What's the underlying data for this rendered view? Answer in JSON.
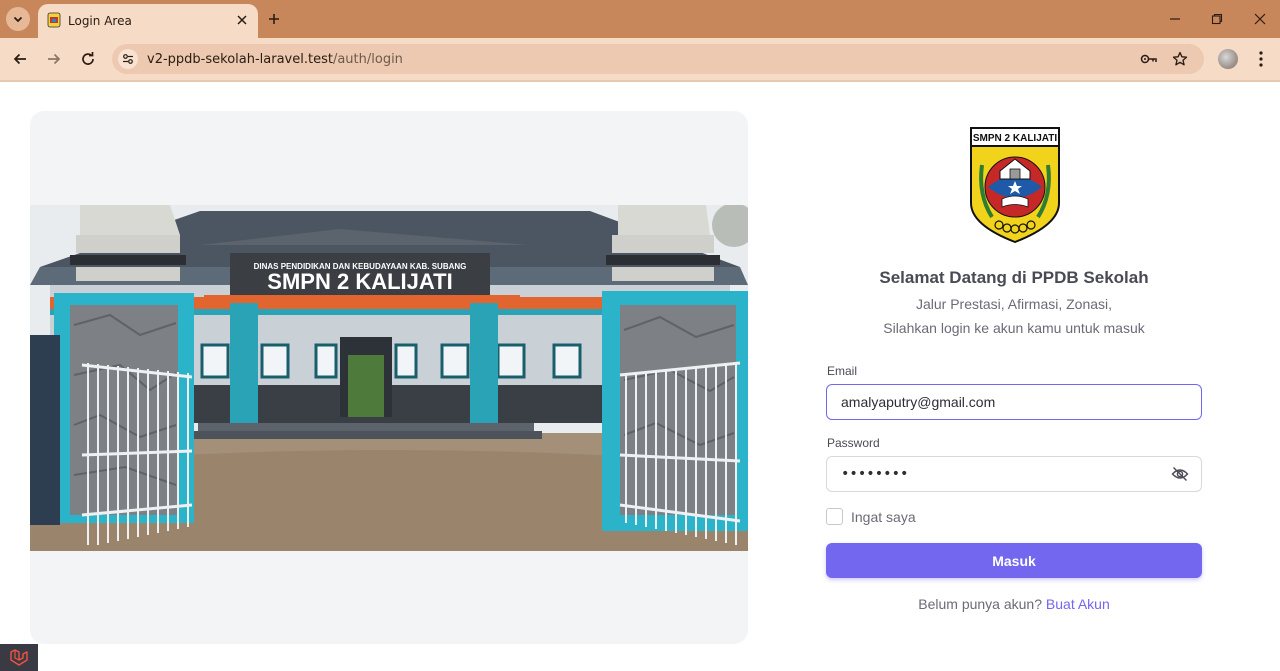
{
  "browser": {
    "tab_title": "Login Area",
    "url_host": "v2-ppdb-sekolah-laravel.test",
    "url_path": "/auth/login",
    "icons": [
      "tab-search-icon",
      "close-icon",
      "plus-icon",
      "minimize-icon",
      "restore-icon",
      "close-window-icon",
      "back-arrow-icon",
      "forward-arrow-icon",
      "reload-icon",
      "site-settings-icon",
      "key-icon",
      "star-icon",
      "profile-avatar",
      "kebab-menu-icon"
    ],
    "theme": {
      "tabbar": "#c8875a",
      "toolbar": "#f6dcc6"
    }
  },
  "photo": {
    "sign_line1": "DINAS PENDIDIKAN DAN KEBUDAYAAN KAB. SUBANG",
    "sign_line2": "SMPN 2 KALIJATI"
  },
  "logo": {
    "banner_text": "SMPN 2 KALIJATI"
  },
  "login": {
    "title": "Selamat Datang di PPDB Sekolah",
    "subtitle_line1": "Jalur Prestasi, Afirmasi, Zonasi,",
    "subtitle_line2": "Silahkan login ke akun kamu untuk masuk",
    "email_label": "Email",
    "email_value": "amalyaputry@gmail.com",
    "password_label": "Password",
    "password_value": "••••••••",
    "remember_label": "Ingat saya",
    "remember_checked": false,
    "submit_label": "Masuk",
    "register_prompt": "Belum punya akun?",
    "register_link": "Buat Akun",
    "accent_color": "#7367f0"
  }
}
